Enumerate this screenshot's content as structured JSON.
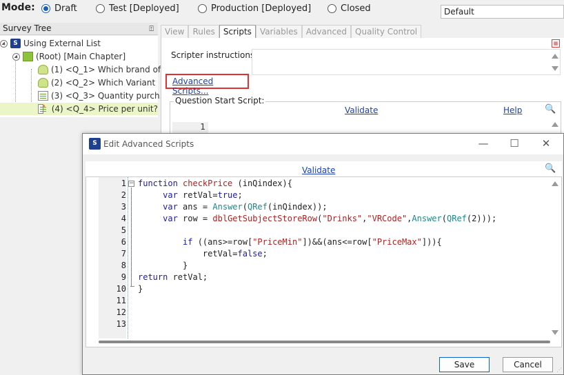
{
  "mode_bar": {
    "label": "Mode:",
    "options": [
      {
        "label": "Draft",
        "selected": true
      },
      {
        "label": "Test [Deployed]",
        "selected": false
      },
      {
        "label": "Production [Deployed]",
        "selected": false
      },
      {
        "label": "Closed",
        "selected": false
      }
    ],
    "dropdown_value": "Default"
  },
  "survey_tree": {
    "title": "Survey Tree",
    "items": [
      {
        "label": "Using External List",
        "icon": "survey-icon"
      },
      {
        "label": "(Root) [Main Chapter]",
        "icon": "chapter-icon"
      },
      {
        "label": "(1) <Q_1> Which brand of...",
        "icon": "question-icon"
      },
      {
        "label": "(2) <Q_2> Which Variant",
        "icon": "question-icon"
      },
      {
        "label": "(3) <Q_3> Quantity purch...",
        "icon": "grid-question-icon"
      },
      {
        "label": "(4) <Q_4> Price per unit?",
        "icon": "grid-question-icon",
        "selected": true
      }
    ]
  },
  "tabs": [
    {
      "label": "View",
      "active": false
    },
    {
      "label": "Rules",
      "active": false
    },
    {
      "label": "Scripts",
      "active": true
    },
    {
      "label": "Variables",
      "active": false
    },
    {
      "label": "Advanced",
      "active": false
    },
    {
      "label": "Quality Control",
      "active": false
    }
  ],
  "scripts_panel": {
    "instructions_label": "Scripter instructions:",
    "advanced_link": "Advanced Scripts...",
    "start_script_label": "Question Start Script:",
    "validate_link": "Validate",
    "help_link": "Help",
    "first_line_number": "1"
  },
  "dialog": {
    "title": "Edit Advanced Scripts",
    "validate_link": "Validate",
    "line_numbers": [
      "1",
      "2",
      "3",
      "4",
      "5",
      "6",
      "7",
      "8",
      "9",
      "10",
      "11",
      "12",
      "13"
    ],
    "save_label": "Save",
    "cancel_label": "Cancel",
    "code": [
      [
        {
          "t": "function",
          "c": "kw"
        },
        {
          "t": " "
        },
        {
          "t": "checkPrice",
          "c": "fn"
        },
        {
          "t": " (inQindex){"
        }
      ],
      [
        {
          "t": "     "
        },
        {
          "t": "var",
          "c": "kw"
        },
        {
          "t": " retVal="
        },
        {
          "t": "true",
          "c": "kw"
        },
        {
          "t": ";"
        }
      ],
      [
        {
          "t": "     "
        },
        {
          "t": "var",
          "c": "kw"
        },
        {
          "t": " ans = "
        },
        {
          "t": "Answer",
          "c": "api"
        },
        {
          "t": "("
        },
        {
          "t": "QRef",
          "c": "api"
        },
        {
          "t": "(inQindex));"
        }
      ],
      [
        {
          "t": "     "
        },
        {
          "t": "var",
          "c": "kw"
        },
        {
          "t": " row = "
        },
        {
          "t": "dblGetSubjectStoreRow",
          "c": "fn"
        },
        {
          "t": "("
        },
        {
          "t": "\"Drinks\"",
          "c": "str"
        },
        {
          "t": ","
        },
        {
          "t": "\"VRCode\"",
          "c": "str"
        },
        {
          "t": ","
        },
        {
          "t": "Answer",
          "c": "api"
        },
        {
          "t": "("
        },
        {
          "t": "QRef",
          "c": "api"
        },
        {
          "t": "(2)));"
        }
      ],
      [],
      [
        {
          "t": "         "
        },
        {
          "t": "if",
          "c": "kw"
        },
        {
          "t": " ((ans>=row["
        },
        {
          "t": "\"PriceMin\"",
          "c": "str"
        },
        {
          "t": "])&&(ans<=row["
        },
        {
          "t": "\"PriceMax\"",
          "c": "str"
        },
        {
          "t": "])){"
        }
      ],
      [
        {
          "t": "             retVal="
        },
        {
          "t": "false",
          "c": "kw"
        },
        {
          "t": ";"
        }
      ],
      [
        {
          "t": "         }"
        }
      ],
      [
        {
          "t": "return",
          "c": "kw"
        },
        {
          "t": " retVal;"
        }
      ],
      [
        {
          "t": "}"
        }
      ],
      [],
      [],
      []
    ]
  }
}
